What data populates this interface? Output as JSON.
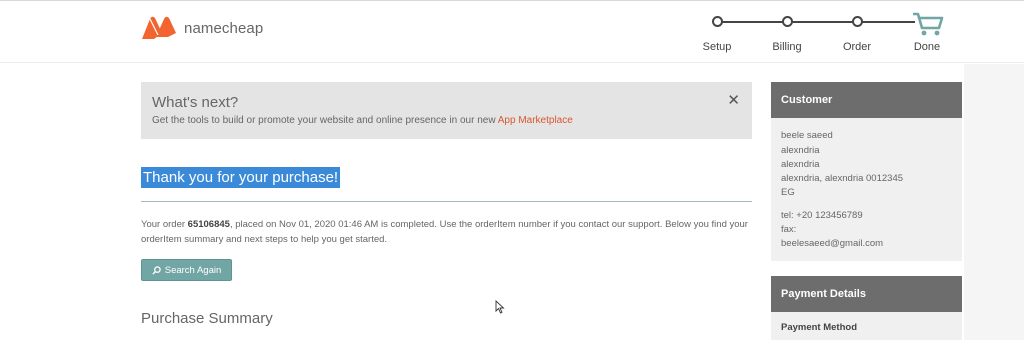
{
  "brand": {
    "name": "namecheap",
    "accent": "#f26430"
  },
  "steps": [
    {
      "label": "Setup"
    },
    {
      "label": "Billing"
    },
    {
      "label": "Order"
    },
    {
      "label": "Done"
    }
  ],
  "whats_next": {
    "title": "What's next?",
    "text": "Get the tools to build or promote your website and online presence in our new ",
    "link": "App Marketplace",
    "close": "✕"
  },
  "thanks": "Thank you for your purchase!",
  "order": {
    "prefix": "Your order ",
    "number": "65106845",
    "suffix": ", placed on Nov 01, 2020 01:46 AM is completed. Use the orderItem number if you contact our support. Below you find your orderItem summary and next steps to help you get started."
  },
  "search_again": "Search Again",
  "purchase_summary": "Purchase Summary",
  "customer": {
    "heading": "Customer",
    "name": "beele saeed",
    "address1": "alexndria",
    "address2": "alexndria",
    "city_line": "alexndria, alexndria 0012345",
    "country": "EG",
    "tel": "tel: +20 123456789",
    "fax": "fax:",
    "email": "beelesaeed@gmail.com"
  },
  "payment": {
    "heading": "Payment Details",
    "method_label": "Payment Method"
  }
}
